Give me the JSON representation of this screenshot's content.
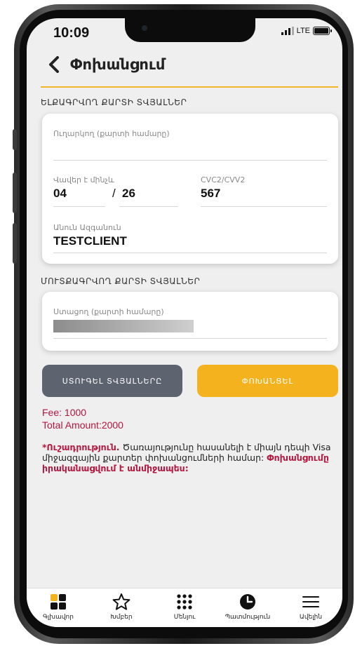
{
  "status_bar": {
    "time": "10:09",
    "network": "LTE"
  },
  "header": {
    "title": "Փոխանցում"
  },
  "sender_section": {
    "title": "ԵԼՔԱԳՐՎՈՂ ՔԱՐՏԻ ՏՎՅԱԼՆԵՐ",
    "card_number_label": "Ուղարկող (քարտի համարը)",
    "card_number_value": "",
    "expiry_label": "Վավեր է մինչև",
    "expiry_month": "04",
    "expiry_separator": "/",
    "expiry_year": "26",
    "cvc_label": "CVC2/CVV2",
    "cvc_value": "567",
    "name_label": "Անուն Ազգանուն",
    "name_value": "TESTCLIENT"
  },
  "receiver_section": {
    "title": "ՄՈՒՏՔԱԳՐՎՈՂ ՔԱՐՏԻ ՏՎՅԱԼՆԵՐ",
    "card_number_label": "Ստացող (քարտի համարը)"
  },
  "buttons": {
    "check": "ՍՏՈՒԳԵԼ ՏՎՅԱԼՆԵՐԸ",
    "transfer": "ՓՈԽԱՆՑԵԼ"
  },
  "fees": {
    "fee": "Fee: 1000",
    "total": "Total Amount:2000"
  },
  "note": {
    "attention": "*Ուշադրություն.",
    "text": " Ծառայությունը հասանելի է միայն դեպի Visa միջազգային քարտեր փոխանցումների համար: ",
    "emphasis": "Փոխանցումը իրականացվում է անմիջապես:"
  },
  "tabbar": [
    {
      "label": "Գլխավոր",
      "icon": "home-grid-icon"
    },
    {
      "label": "Խմբեր",
      "icon": "star-icon"
    },
    {
      "label": "Մենյու",
      "icon": "dots-grid-icon"
    },
    {
      "label": "Պատմություն",
      "icon": "clock-icon"
    },
    {
      "label": "Ավելին",
      "icon": "hamburger-icon"
    }
  ],
  "colors": {
    "accent": "#f4b21e",
    "secondary_button": "#5e6370",
    "highlight_text": "#b3163e"
  }
}
